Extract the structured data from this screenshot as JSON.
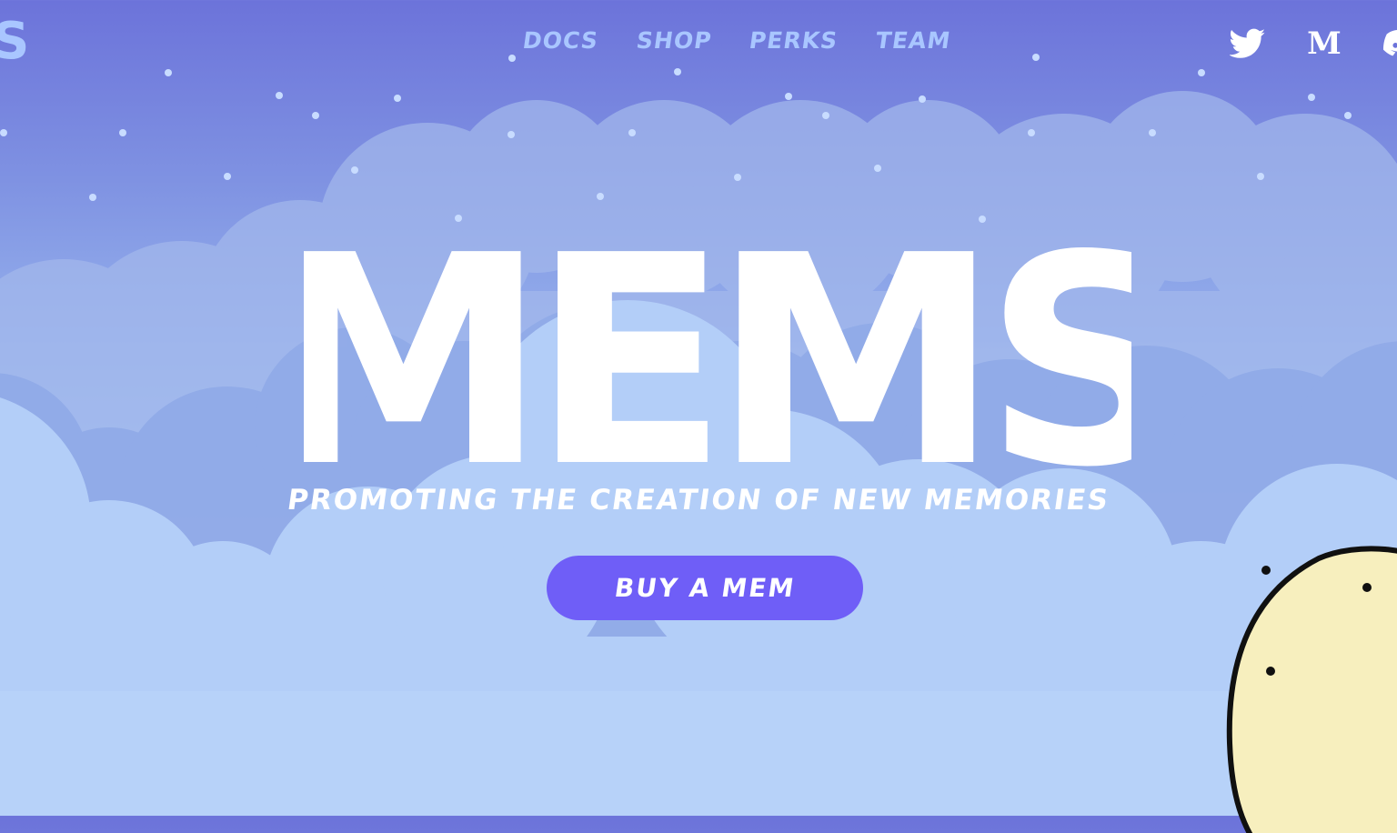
{
  "navigation": {
    "links": [
      {
        "label": "DOCS"
      },
      {
        "label": "SHOP"
      },
      {
        "label": "PERKS"
      },
      {
        "label": "TEAM"
      }
    ]
  },
  "brand": {
    "logo_fragment": "S"
  },
  "social": [
    {
      "icon": "twitter-icon"
    },
    {
      "icon": "medium-icon",
      "label": "M"
    },
    {
      "icon": "discord-icon"
    }
  ],
  "hero": {
    "title": "MEMS",
    "subtitle": "PROMOTING THE CREATION OF NEW MEMORIES",
    "button_label": "BUY A MEM"
  },
  "colors": {
    "background_top": "#6c73da",
    "background_bottom": "#c9dcfb",
    "nav_text": "#a9c6ff",
    "button": "#6f5ef7",
    "mascot": "#f7efbe"
  }
}
